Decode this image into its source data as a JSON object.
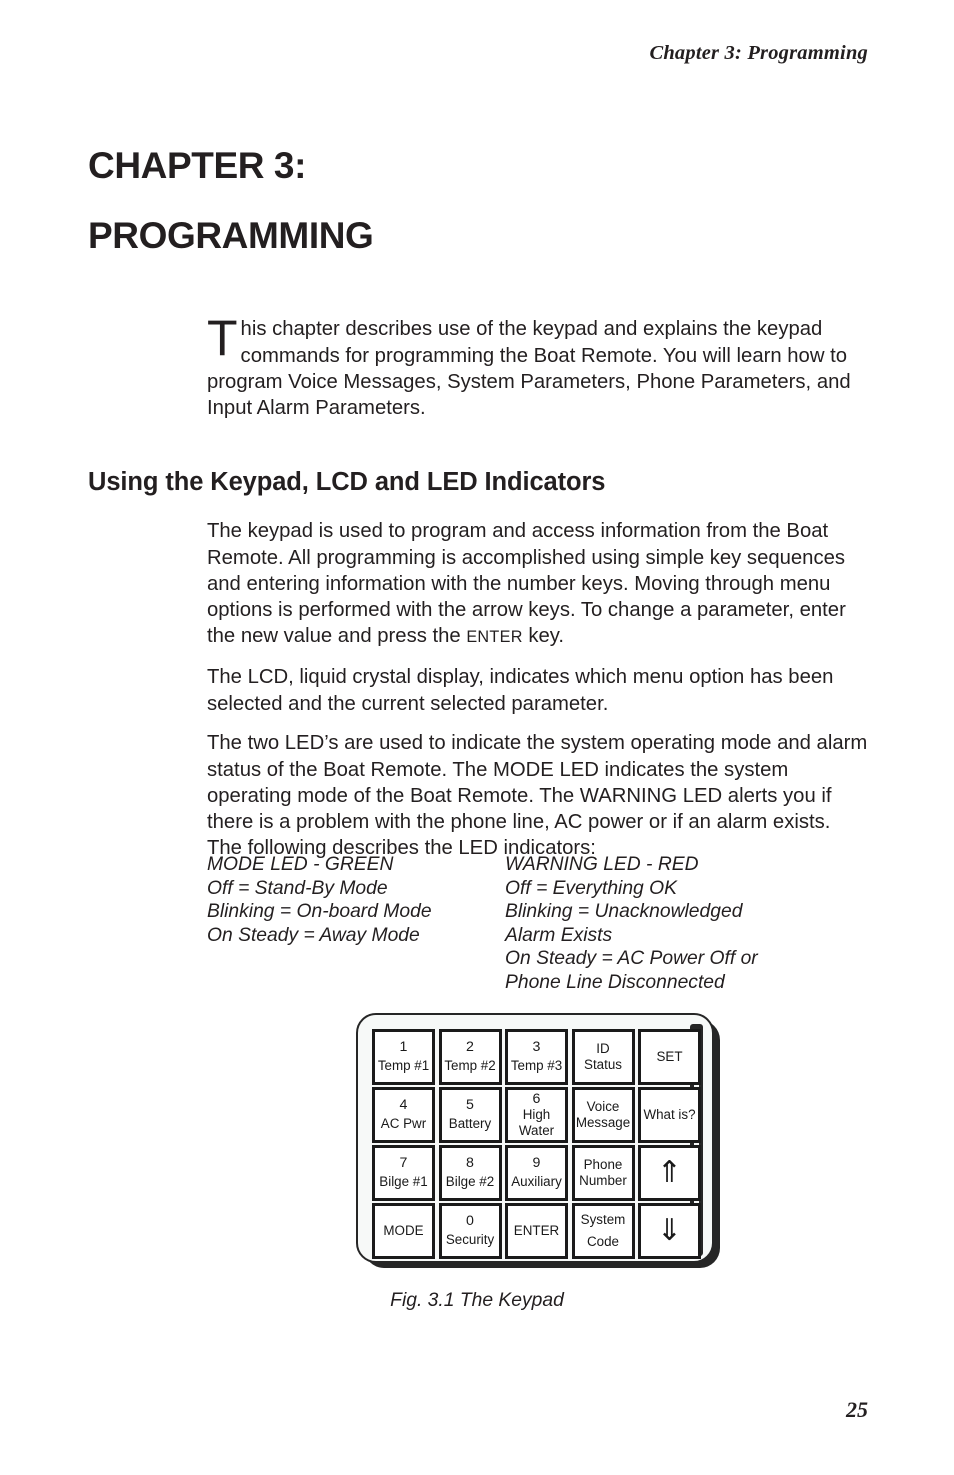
{
  "running_head": "Chapter 3: Programming",
  "chapter": {
    "line1": "CHAPTER 3:",
    "line2": "PROGRAMMING"
  },
  "intro": {
    "dropcap": "T",
    "text": "his chapter describes use of the keypad and explains the keypad commands for programming the Boat Remote. You will learn how to program Voice Messages, System Parameters, Phone Parameters, and Input Alarm Parameters."
  },
  "section": {
    "heading": "Using the Keypad, LCD and LED Indicators",
    "paragraph_keypad_a": "The keypad is used to program and access information from the Boat Remote. All programming is accomplished using simple key sequences and entering information with the number keys. Moving through menu options is performed with the arrow keys. To change a parameter, enter the new value and press the ",
    "paragraph_keypad_enter": "ENTER",
    "paragraph_keypad_b": " key.",
    "paragraph_lcd": "The LCD, liquid crystal display, indicates which menu option has been selected and the current selected parameter.",
    "paragraph_leds": "The two LED’s are used to indicate the system operating mode and alarm status of the Boat Remote. The MODE LED indicates the system operating mode of the Boat Remote. The WARNING LED alerts you if there is a problem with the phone line, AC power or if an alarm exists. The following describes the LED indicators:"
  },
  "led_indicators": {
    "mode": {
      "title": "MODE LED - GREEN",
      "lines": "MODE LED - GREEN\nOff = Stand-By Mode\nBlinking = On-board Mode\nOn Steady = Away Mode",
      "color": "#008000"
    },
    "warning": {
      "title": "WARNING LED - RED",
      "lines": "WARNING LED - RED\nOff = Everything OK\nBlinking = Unacknowledged\nAlarm Exists\nOn Steady = AC Power Off or\nPhone Line Disconnected",
      "color": "#cc0000"
    }
  },
  "keypad": {
    "caption": "Fig. 3.1 The Keypad",
    "keys": [
      {
        "num": "1",
        "label": "Temp #1",
        "layout": "split"
      },
      {
        "num": "2",
        "label": "Temp #2",
        "layout": "split"
      },
      {
        "num": "3",
        "label": "Temp #3",
        "layout": "split"
      },
      {
        "num": "",
        "label": "ID\nStatus",
        "layout": "center"
      },
      {
        "num": "",
        "label": "SET",
        "layout": "center"
      },
      {
        "num": "4",
        "label": "AC  Pwr",
        "layout": "split"
      },
      {
        "num": "5",
        "label": "Battery",
        "layout": "split"
      },
      {
        "num": "6",
        "label": "High\nWater",
        "layout": "stack"
      },
      {
        "num": "",
        "label": "Voice\nMessage",
        "layout": "center"
      },
      {
        "num": "",
        "label": "What is?",
        "layout": "center"
      },
      {
        "num": "7",
        "label": "Bilge #1",
        "layout": "split"
      },
      {
        "num": "8",
        "label": "Bilge #2",
        "layout": "split"
      },
      {
        "num": "9",
        "label": "Auxiliary",
        "layout": "split"
      },
      {
        "num": "",
        "label": "Phone\nNumber",
        "layout": "center"
      },
      {
        "num": "",
        "label": "",
        "icon": "arrow-up-icon",
        "glyph": "⇑",
        "layout": "icon"
      },
      {
        "num": "",
        "label": "MODE",
        "layout": "center"
      },
      {
        "num": "0",
        "label": "Security",
        "layout": "split"
      },
      {
        "num": "",
        "label": "ENTER",
        "layout": "center"
      },
      {
        "num": "",
        "label": "System\n\nCode",
        "layout": "spaced"
      },
      {
        "num": "",
        "label": "",
        "icon": "arrow-down-icon",
        "glyph": "⇓",
        "layout": "icon"
      }
    ]
  },
  "page_number": "25"
}
